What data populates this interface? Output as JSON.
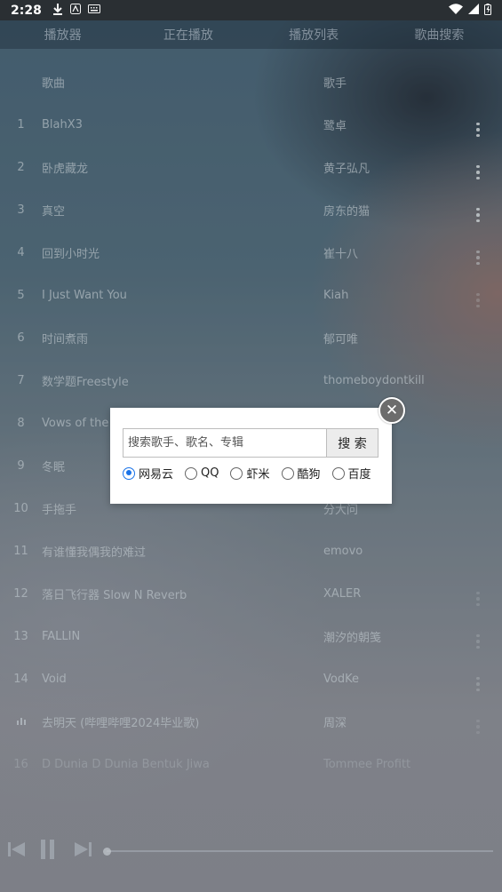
{
  "status_bar": {
    "time": "2:28"
  },
  "tabs": [
    "播放器",
    "正在播放",
    "播放列表",
    "歌曲搜索"
  ],
  "list_header": {
    "title": "歌曲",
    "artist": "歌手"
  },
  "songs": [
    {
      "num": "1",
      "title": "BlahX3",
      "artist": "鹭卓"
    },
    {
      "num": "2",
      "title": "卧虎藏龙",
      "artist": "黄子弘凡"
    },
    {
      "num": "3",
      "title": "真空",
      "artist": "房东的猫"
    },
    {
      "num": "4",
      "title": "回到小时光",
      "artist": "崔十八"
    },
    {
      "num": "5",
      "title": "I Just Want You",
      "artist": "Kiah"
    },
    {
      "num": "6",
      "title": "时间煮雨",
      "artist": "郁可唯"
    },
    {
      "num": "7",
      "title": "数学题Freestyle",
      "artist": "thomeboydontkill"
    },
    {
      "num": "8",
      "title": "Vows of the",
      "artist": ""
    },
    {
      "num": "9",
      "title": "冬眠",
      "artist": ""
    },
    {
      "num": "10",
      "title": "手拖手",
      "artist": "分大问"
    },
    {
      "num": "11",
      "title": "有谁懂我偶我的难过",
      "artist": "emovo"
    },
    {
      "num": "12",
      "title": "落日飞行器 Slow N Reverb",
      "artist": "XALER"
    },
    {
      "num": "13",
      "title": "FALLIN",
      "artist": "潮汐的朝笺"
    },
    {
      "num": "14",
      "title": "Void",
      "artist": "VodKe"
    },
    {
      "num": "",
      "title": "去明天 (哔哩哔哩2024毕业歌)",
      "artist": "周深"
    },
    {
      "num": "16",
      "title": "D Dunia D Dunia Bentuk Jiwa",
      "artist": "Tommee Profitt"
    }
  ],
  "dialog": {
    "search_placeholder": "搜索歌手、歌名、专辑",
    "search_button": "搜 索",
    "sources": [
      {
        "label": "网易云",
        "checked": true
      },
      {
        "label": "QQ",
        "checked": false
      },
      {
        "label": "虾米",
        "checked": false
      },
      {
        "label": "酷狗",
        "checked": false
      },
      {
        "label": "百度",
        "checked": false
      }
    ]
  },
  "player": {
    "progress": 0
  }
}
